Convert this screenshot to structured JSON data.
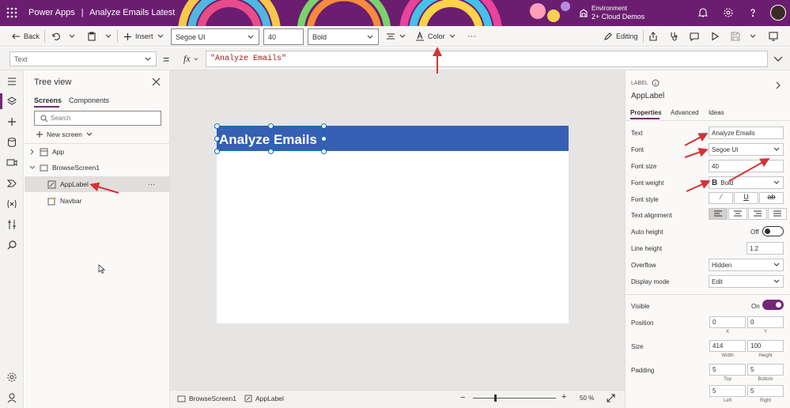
{
  "header": {
    "app": "Power Apps",
    "separator": "|",
    "doc_title": "Analyze Emails Latest",
    "env_label": "Environment",
    "env_name": "2+ Cloud Demos"
  },
  "commands": {
    "back": "Back",
    "insert": "Insert",
    "font": "Segoe UI",
    "size": "40",
    "weight": "Bold",
    "color": "Color",
    "editing": "Editing"
  },
  "formula": {
    "property": "Text",
    "eq": "=",
    "fx": "fx",
    "value": "\"Analyze Emails\""
  },
  "tree": {
    "title": "Tree view",
    "tabs": [
      "Screens",
      "Components"
    ],
    "search_placeholder": "Search",
    "new_screen": "New screen",
    "items": [
      "App",
      "BrowseScreen1",
      "AppLabel",
      "Navbar"
    ],
    "more": "···"
  },
  "canvas": {
    "label_text": "Analyze Emails"
  },
  "status": {
    "screen": "BrowseScreen1",
    "control": "AppLabel",
    "zoom_minus": "−",
    "zoom_plus": "+",
    "zoom": "50",
    "zoom_unit": "%"
  },
  "props": {
    "type": "LABEL",
    "name": "AppLabel",
    "tabs": [
      "Properties",
      "Advanced",
      "Ideas"
    ],
    "text_label": "Text",
    "text_value": "Analyze Emails",
    "font_label": "Font",
    "font_value": "Segoe UI",
    "size_label": "Font size",
    "size_value": "40",
    "weight_label": "Font weight",
    "weight_value": "Bold",
    "style_label": "Font style",
    "align_label": "Text alignment",
    "autoh_label": "Auto height",
    "autoh_value": "Off",
    "lineh_label": "Line height",
    "lineh_value": "1.2",
    "overflow_label": "Overflow",
    "overflow_value": "Hidden",
    "mode_label": "Display mode",
    "mode_value": "Edit",
    "visible_label": "Visible",
    "visible_value": "On",
    "pos_label": "Position",
    "x": "0",
    "y": "0",
    "x_cap": "X",
    "y_cap": "Y",
    "size2_label": "Size",
    "w": "414",
    "h": "100",
    "w_cap": "Width",
    "h_cap": "Height",
    "pad_label": "Padding",
    "pt": "5",
    "pb": "5",
    "pl": "5",
    "pr": "5",
    "pt_cap": "Top",
    "pb_cap": "Bottom",
    "pl_cap": "Left",
    "pr_cap": "Right"
  },
  "colors": {
    "brand": "#742774",
    "label_fill": "#3560b3",
    "annotation": "#d13438"
  }
}
